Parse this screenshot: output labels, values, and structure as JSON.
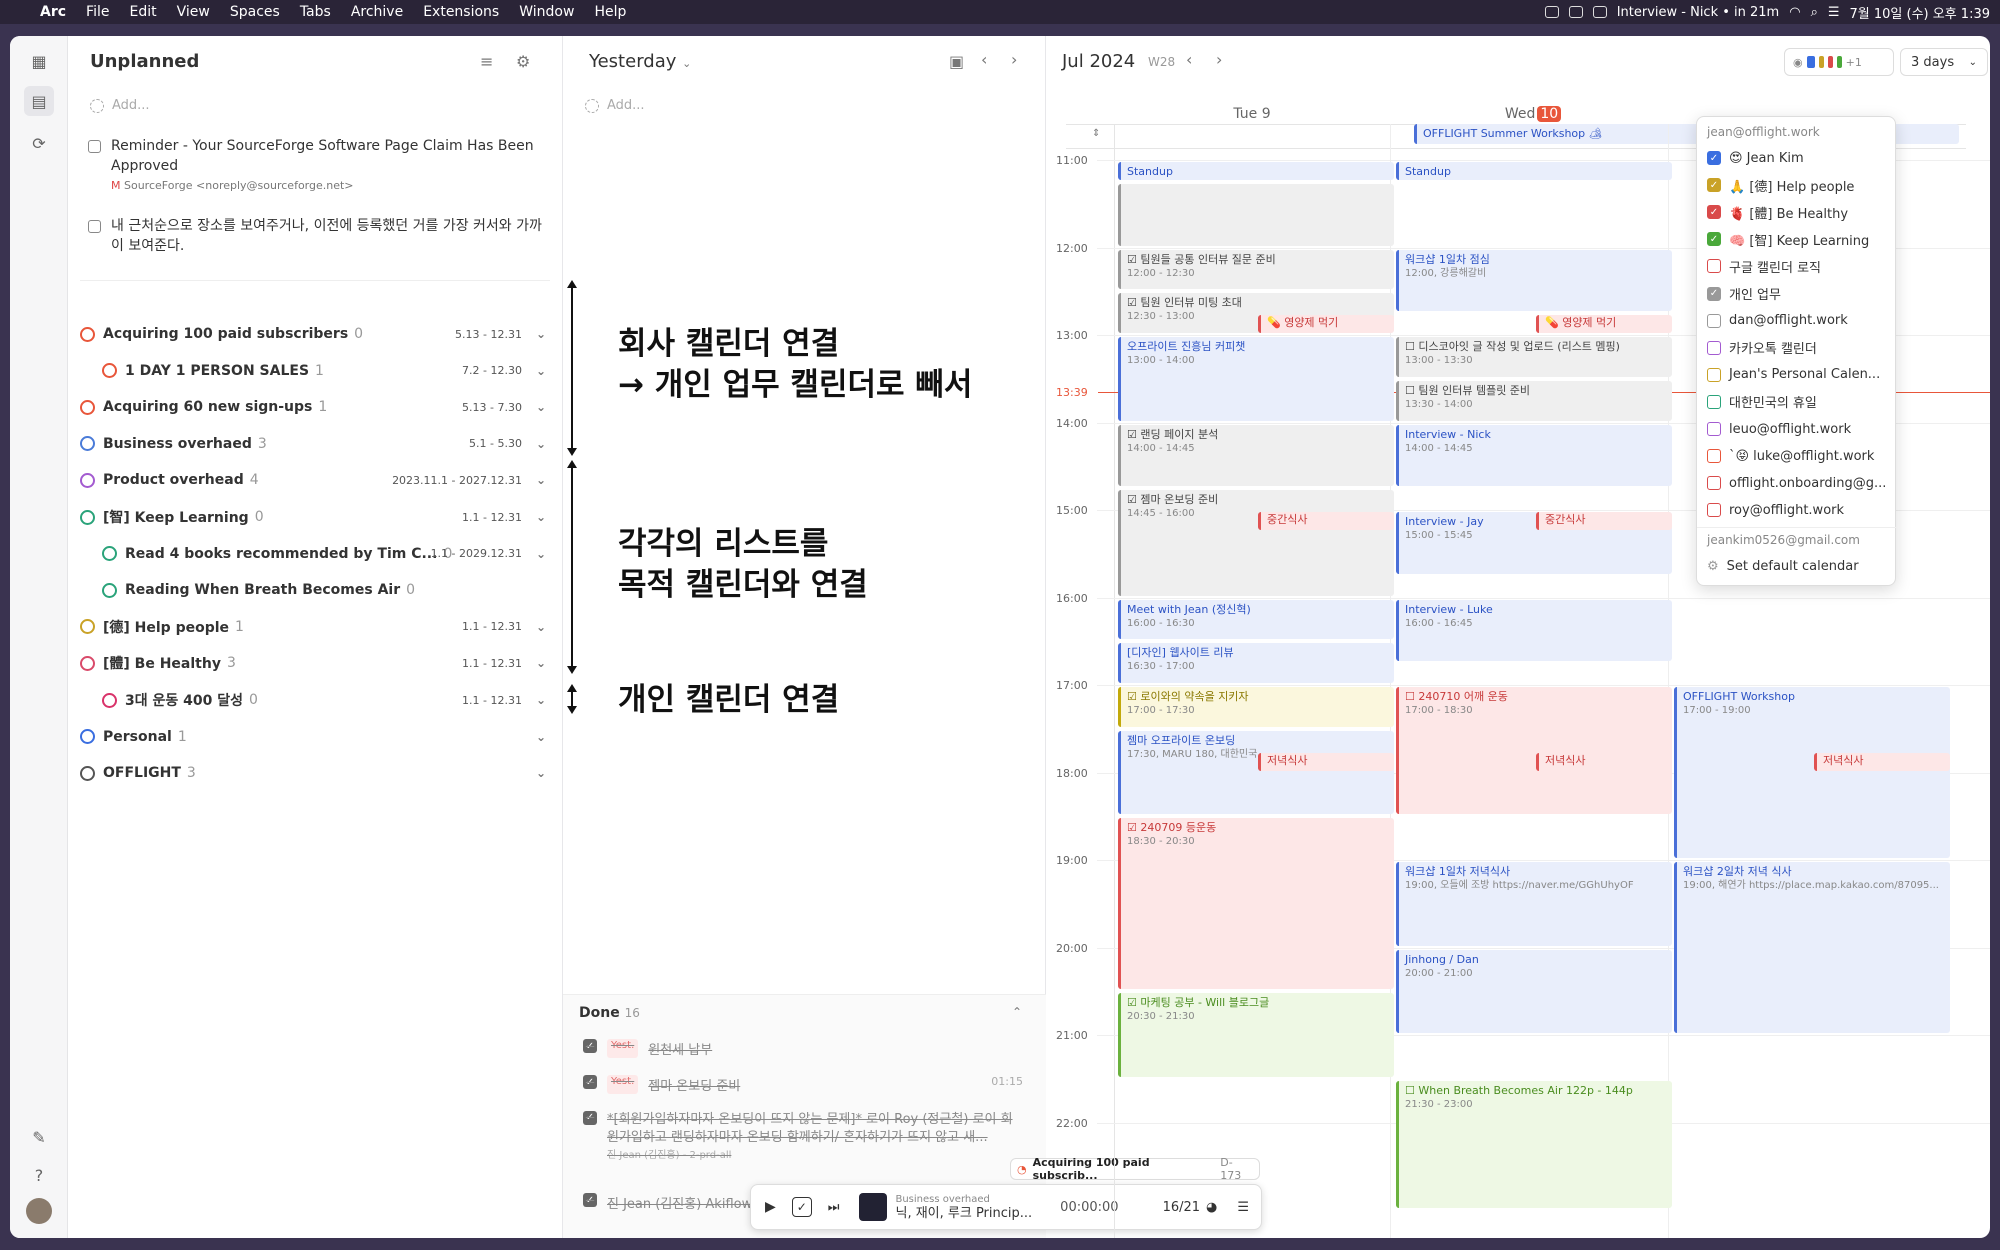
{
  "menubar": {
    "app": "Arc",
    "items": [
      "File",
      "Edit",
      "View",
      "Spaces",
      "Tabs",
      "Archive",
      "Extensions",
      "Window",
      "Help"
    ],
    "meeting": "Interview - Nick • in 21m",
    "datetime": "7월 10일 (수) 오후 1:39"
  },
  "unplanned": {
    "title": "Unplanned",
    "add": "Add...",
    "tasks": [
      {
        "text": "Reminder - Your SourceForge Software Page Claim Has Been Approved",
        "sub": "SourceForge <noreply@sourceforge.net>"
      },
      {
        "text": "내 근처순으로 장소를 보여주거나, 이전에 등록했던 거를 가장 커서와 가까이 보여준다.",
        "sub": ""
      }
    ],
    "projects": [
      {
        "name": "Acquiring 100 paid subscribers",
        "count": "0",
        "range": "5.13 - 12.31",
        "color": "#e8563a",
        "child": false
      },
      {
        "name": "1 DAY 1 PERSON SALES",
        "count": "1",
        "range": "7.2 - 12.30",
        "color": "#e8563a",
        "child": true
      },
      {
        "name": "Acquiring 60 new sign-ups",
        "count": "1",
        "range": "5.13 - 7.30",
        "color": "#e8563a",
        "child": false
      },
      {
        "name": "Business overhaed",
        "count": "3",
        "range": "5.1 - 5.30",
        "color": "#4a7bd8",
        "child": false
      },
      {
        "name": "Product overhead",
        "count": "4",
        "range": "2023.11.1 - 2027.12.31",
        "color": "#a35bd0",
        "child": false
      },
      {
        "name": "[智] Keep Learning",
        "count": "0",
        "range": "1.1 - 12.31",
        "color": "#2aa37a",
        "child": false
      },
      {
        "name": "Read 4 books recommended by Tim C...",
        "count": "0",
        "range": "1.1 - 2029.12.31",
        "color": "#2aa37a",
        "child": true
      },
      {
        "name": "Reading When Breath Becomes Air",
        "count": "0",
        "range": "",
        "color": "#2aa37a",
        "child": true
      },
      {
        "name": "[德] Help people",
        "count": "1",
        "range": "1.1 - 12.31",
        "color": "#c9a227",
        "child": false
      },
      {
        "name": "[體] Be Healthy",
        "count": "3",
        "range": "1.1 - 12.31",
        "color": "#d94a6a",
        "child": false
      },
      {
        "name": "3대 운동 400 달성",
        "count": "0",
        "range": "1.1 - 12.31",
        "color": "#d9336a",
        "child": true
      },
      {
        "name": "Personal",
        "count": "1",
        "range": "",
        "color": "#3a6ee0",
        "child": false
      },
      {
        "name": "OFFLIGHT",
        "count": "3",
        "range": "",
        "color": "#555",
        "child": false
      }
    ]
  },
  "annotations": {
    "a1": "회사 캘린더 연결",
    "a2": "→ 개인 업무 캘린더로 빼서",
    "a3": "각각의 리스트를",
    "a4": "목적 캘린더와 연결",
    "a5": "개인 캘린더 연결"
  },
  "yesterday": {
    "title": "Yesterday",
    "add": "Add...",
    "done_label": "Done",
    "done_count": "16",
    "done": [
      {
        "tag": "Yest.",
        "text": "원천세 납부",
        "time": ""
      },
      {
        "tag": "Yest.",
        "text": "젬마 온보딩 준비",
        "time": "01:15"
      },
      {
        "tag": "",
        "text": "*[회원가입하자마자 온보딩이 뜨지 않는 문제]* 로이 Roy (정근철) 로이 회원가입하고 랜딩하자마자 온보딩 함께하기/ 혼자하기가 뜨지 않고 새...",
        "time": ""
      },
      {
        "tag": "",
        "text": "진 Jean (김진홍) Akiflow ... 니다!",
        "time": ""
      }
    ],
    "done_sub": "진 Jean (김진홍) - 2-prd-all"
  },
  "player": {
    "tag": "Acquiring 100 paid subscrib...",
    "tag_id": "D-173",
    "project": "Business overhaed",
    "title": "닉, 재이, 루크 Princip...",
    "timer": "00:00:00",
    "progress": "16/21"
  },
  "calendar": {
    "month": "Jul 2024",
    "week": "W28",
    "view": "3 days",
    "plus": "+1",
    "days": [
      "Tue 9",
      "Wed",
      "10"
    ],
    "hours": [
      "11:00",
      "12:00",
      "13:00",
      "14:00",
      "15:00",
      "16:00",
      "17:00",
      "18:00",
      "19:00",
      "20:00",
      "21:00",
      "22:00"
    ],
    "now": "13:39",
    "allday": "OFFLIGHT Summer Workshop 🏕",
    "events": [
      {
        "c": 0,
        "s": 11.0,
        "e": 11.25,
        "ttl": "Standup",
        "t": "",
        "k": "blue"
      },
      {
        "c": 1,
        "s": 11.0,
        "e": 11.25,
        "ttl": "Standup",
        "t": "",
        "k": "blue"
      },
      {
        "c": 0,
        "s": 11.25,
        "e": 12.0,
        "ttl": "",
        "t": "",
        "k": "gray"
      },
      {
        "c": 0,
        "s": 12.0,
        "e": 12.5,
        "ttl": "☑ 팀원들 공통 인터뷰 질문 준비",
        "t": "12:00 - 12:30",
        "k": "gray"
      },
      {
        "c": 0,
        "s": 12.5,
        "e": 13.0,
        "ttl": "☑ 팀원 인터뷰 미팅 초대",
        "t": "12:30 - 13:00",
        "k": "gray"
      },
      {
        "c": 1,
        "s": 12.0,
        "e": 12.75,
        "ttl": "워크샵 1일차 점심",
        "t": "12:00, 강릉해갈비",
        "k": "blue"
      },
      {
        "c": 0,
        "s": 13.0,
        "e": 14.0,
        "ttl": "오프라이트 진흥님 커피챗",
        "t": "13:00 - 14:00",
        "k": "blue"
      },
      {
        "c": 1,
        "s": 13.0,
        "e": 13.5,
        "ttl": "☐ 디스코아잇 글 작성 및 업로드 (리스트 멤핑)",
        "t": "13:00 - 13:30",
        "k": "gray"
      },
      {
        "c": 1,
        "s": 13.5,
        "e": 14.0,
        "ttl": "☐ 팀원 인터뷰 템플릿 준비",
        "t": "13:30 - 14:00",
        "k": "gray"
      },
      {
        "c": 0,
        "s": 14.0,
        "e": 14.75,
        "ttl": "☑ 랜딩 페이지 분석",
        "t": "14:00 - 14:45",
        "k": "gray"
      },
      {
        "c": 1,
        "s": 14.0,
        "e": 14.75,
        "ttl": "Interview - Nick",
        "t": "14:00 - 14:45",
        "k": "blue"
      },
      {
        "c": 0,
        "s": 14.75,
        "e": 16.0,
        "ttl": "☑ 젬마 온보딩 준비",
        "t": "14:45 - 16:00",
        "k": "gray"
      },
      {
        "c": 1,
        "s": 15.0,
        "e": 15.75,
        "ttl": "Interview - Jay",
        "t": "15:00 - 15:45",
        "k": "blue"
      },
      {
        "c": 0,
        "s": 16.0,
        "e": 16.5,
        "ttl": "Meet with Jean (정신혁)",
        "t": "16:00 - 16:30",
        "k": "blue"
      },
      {
        "c": 1,
        "s": 16.0,
        "e": 16.75,
        "ttl": "Interview - Luke",
        "t": "16:00 - 16:45",
        "k": "blue"
      },
      {
        "c": 0,
        "s": 16.5,
        "e": 17.0,
        "ttl": "[디자인] 웹사이트 리뷰",
        "t": "16:30 - 17:00",
        "k": "blue"
      },
      {
        "c": 0,
        "s": 17.0,
        "e": 17.5,
        "ttl": "☑ 로이와의 약속을 지키자",
        "t": "17:00 - 17:30",
        "k": "yellow"
      },
      {
        "c": 1,
        "s": 17.0,
        "e": 18.5,
        "ttl": "☐ 240710 어깨 운동",
        "t": "17:00 - 18:30",
        "k": "red"
      },
      {
        "c": 2,
        "s": 17.0,
        "e": 19.0,
        "ttl": "OFFLIGHT Workshop",
        "t": "17:00 - 19:00",
        "k": "blue"
      },
      {
        "c": 0,
        "s": 17.5,
        "e": 18.5,
        "ttl": "젬마 오프라이트 온보딩",
        "t": "17:30, MARU 180, 대한민국",
        "k": "blue"
      },
      {
        "c": 0,
        "s": 18.5,
        "e": 20.5,
        "ttl": "☑ 240709 등운동",
        "t": "18:30 - 20:30",
        "k": "red"
      },
      {
        "c": 1,
        "s": 19.0,
        "e": 20.0,
        "ttl": "워크샵 1일차 저녁식사",
        "t": "19:00, 오들에 조방 https://naver.me/GGhUhyOF",
        "k": "blue"
      },
      {
        "c": 2,
        "s": 19.0,
        "e": 21.0,
        "ttl": "워크샵 2일차 저녁 식사",
        "t": "19:00, 해연가 https://place.map.kakao.com/87095...",
        "k": "blue"
      },
      {
        "c": 1,
        "s": 20.0,
        "e": 21.0,
        "ttl": "Jinhong / Dan",
        "t": "20:00 - 21:00",
        "k": "blue"
      },
      {
        "c": 0,
        "s": 20.5,
        "e": 21.5,
        "ttl": "☑ 마케팅 공부 - Will 블로그글",
        "t": "20:30 - 21:30",
        "k": "green"
      },
      {
        "c": 1,
        "s": 21.5,
        "e": 23.0,
        "ttl": "☐ When Breath Becomes Air 122p - 144p",
        "t": "21:30 - 23:00",
        "k": "green"
      }
    ],
    "small": [
      {
        "c": 0,
        "s": 12.75,
        "ttl": "💊 영양제 먹기"
      },
      {
        "c": 1,
        "s": 12.75,
        "ttl": "💊 영양제 먹기"
      },
      {
        "c": 0,
        "s": 15.0,
        "ttl": "중간식사"
      },
      {
        "c": 1,
        "s": 15.0,
        "ttl": "중간식사"
      },
      {
        "c": 0,
        "s": 17.75,
        "ttl": "저녁식사"
      },
      {
        "c": 1,
        "s": 17.75,
        "ttl": "저녁식사"
      },
      {
        "c": 2,
        "s": 17.75,
        "ttl": "저녁식사"
      }
    ]
  },
  "dropdown": {
    "account": "jean@offlight.work",
    "footer": "jeankim0526@gmail.com",
    "set_default": "Set default calendar",
    "items": [
      {
        "label": "😍 Jean Kim",
        "checked": true,
        "color": "#3a6ee0"
      },
      {
        "label": "🙏 [德] Help people",
        "checked": true,
        "color": "#c9a227"
      },
      {
        "label": "🫀 [體] Be Healthy",
        "checked": true,
        "color": "#d94a4a"
      },
      {
        "label": "🧠 [智] Keep Learning",
        "checked": true,
        "color": "#4aa83a"
      },
      {
        "label": "구글 캘린더 로직",
        "checked": false,
        "color": "#d94a4a"
      },
      {
        "label": "개인 업무",
        "checked": true,
        "color": "#999"
      },
      {
        "label": "dan@offlight.work",
        "checked": false,
        "color": "#999"
      },
      {
        "label": "카카오톡 캘린더",
        "checked": false,
        "color": "#a35bd0"
      },
      {
        "label": "Jean's Personal Calen...",
        "checked": false,
        "color": "#c9a227"
      },
      {
        "label": "대한민국의 휴일",
        "checked": false,
        "color": "#2aa37a"
      },
      {
        "label": "leuo@offlight.work",
        "checked": false,
        "color": "#a35bd0"
      },
      {
        "label": "`😝 luke@offlight.work",
        "checked": false,
        "color": "#e8563a"
      },
      {
        "label": "offlight.onboarding@g...",
        "checked": false,
        "color": "#d94a4a"
      },
      {
        "label": "roy@offlight.work",
        "checked": false,
        "color": "#d94a4a"
      }
    ]
  }
}
